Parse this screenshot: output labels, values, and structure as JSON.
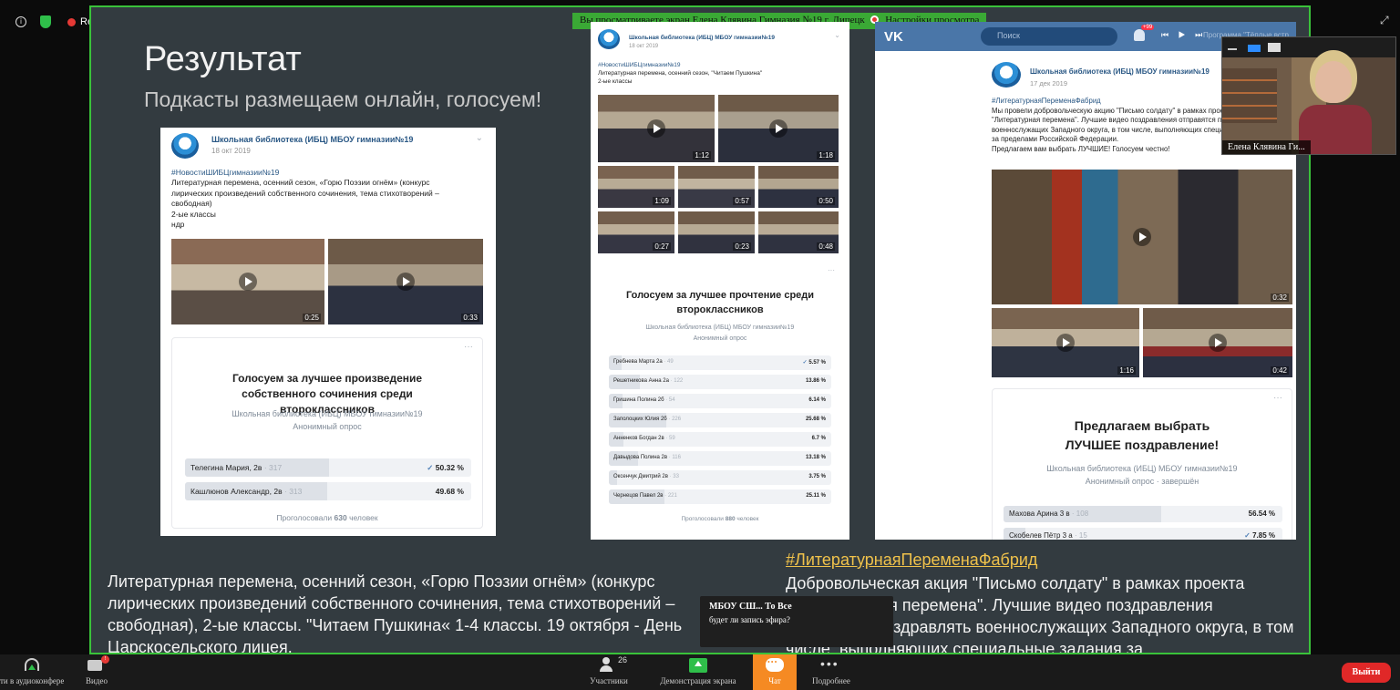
{
  "recording": {
    "label": "Recording"
  },
  "banner": {
    "text": "Вы просматриваете экран Елена Клявина Гимназия №19 г. Липецк",
    "options": "Настройки просмотра"
  },
  "slide": {
    "title": "Результат",
    "subtitle": "Подкасты размещаем онлайн, голосуем!",
    "left_text": "Литературная перемена, осенний сезон, «Горю Поэзии огнём» (конкурс лирических произведений собственного сочинения, тема стихотворений – свободная), 2-ые классы. \"Читаем Пушкина« 1-4 классы. 19 октября - День Царскосельского лицея.",
    "right_tag": "#ЛитературнаяПеременаФабрид",
    "right_text": "Добровольческая акция \"Письмо солдату\" в рамках проекта \"Литературная перемена\". Лучшие видео поздравления отправятся поздравлять военнослужащих Западного округа, в том числе, выполняющих специальные задания за"
  },
  "card1": {
    "org": "Школьная библиотека (ИБЦ) МБОУ гимназии№19",
    "date": "18 окт 2019",
    "tag": "#НовостиШИБЦгимназии№19",
    "text": "Литературная перемена, осенний сезон, «Горю Поэзии огнём» (конкурс лирических произведений собственного сочинения, тема стихотворений – свободная)",
    "classes": "2-ые классы",
    "extra": "ндр",
    "videos": [
      "0:25",
      "0:33"
    ],
    "poll": {
      "title": "Голосуем за лучшее произведение собственного сочинения среди второклассников",
      "org": "Школьная библиотека (ИБЦ) МБОУ гимназии№19",
      "type": "Анонимный опрос",
      "options": [
        {
          "name": "Телегина Мария, 2в",
          "count": "· 317",
          "pct": "50.32 %",
          "fill": 0.5032,
          "checked": "✓"
        },
        {
          "name": "Кашлюнов Александр, 2в",
          "count": "· 313",
          "pct": "49.68 %",
          "fill": 0.4968,
          "checked": ""
        }
      ],
      "voted_prefix": "Проголосовали",
      "voted_count": "630",
      "voted_suffix": "человек"
    }
  },
  "card2": {
    "org": "Школьная библиотека (ИБЦ) МБОУ гимназии№19",
    "date": "18 окт 2019",
    "tag": "#НовостиШИБЦгимназии№19",
    "text": "Литературная перемена, осенний сезон, \"Читаем Пушкина\"",
    "classes": "2-ые классы",
    "videos": [
      "1:12",
      "1:18",
      "1:09",
      "0:57",
      "0:50",
      "0:27",
      "0:23",
      "0:48"
    ],
    "poll": {
      "title": "Голосуем за лучшее прочтение среди второклассников",
      "org": "Школьная библиотека (ИБЦ) МБОУ гимназии№19",
      "type": "Анонимный опрос",
      "options": [
        {
          "name": "Гребнева Марта 2а",
          "count": "· 49",
          "pct": "5.57 %",
          "fill": 0.0557,
          "checked": "✓"
        },
        {
          "name": "Решетникова Анна 2а",
          "count": "· 122",
          "pct": "13.86 %",
          "fill": 0.1386,
          "checked": ""
        },
        {
          "name": "Гришина Полина 2б",
          "count": "· 54",
          "pct": "6.14 %",
          "fill": 0.0614,
          "checked": ""
        },
        {
          "name": "Заполоцких Юлия 2б",
          "count": "· 226",
          "pct": "25.68 %",
          "fill": 0.2568,
          "checked": ""
        },
        {
          "name": "Анненков Богдан 2в",
          "count": "· 59",
          "pct": "6.7 %",
          "fill": 0.067,
          "checked": ""
        },
        {
          "name": "Давыдова Полина 2в",
          "count": "· 116",
          "pct": "13.18 %",
          "fill": 0.1318,
          "checked": ""
        },
        {
          "name": "Оксенчук Дмитрий 2в",
          "count": "· 33",
          "pct": "3.75 %",
          "fill": 0.0375,
          "checked": ""
        },
        {
          "name": "Чернецов Павел 2в",
          "count": "· 221",
          "pct": "25.11 %",
          "fill": 0.2511,
          "checked": ""
        }
      ],
      "voted_prefix": "Проголосовали",
      "voted_count": "880",
      "voted_suffix": "человек"
    }
  },
  "card3": {
    "vk_logo": "VK",
    "search_placeholder": "Поиск",
    "notif_badge": "+99",
    "player": "⏮ ▶ ⏭",
    "now_playing": "Программа \"Тёплые встр",
    "org": "Школьная библиотека (ИБЦ) МБОУ гимназии№19",
    "date": "17 дек 2019",
    "tag": "#ЛитературнаяПеременаФабрид",
    "text": "Мы провели добровольческую акцию \"Письмо солдату\" в рамках проекта \"Литературная перемена\". Лучшие видео поздравления отправятся поздравлять военнослужащих Западного округа, в том числе, выполняющих специальные задания за пределами Российской Федерации.",
    "cta": "Предлагаем вам выбрать ЛУЧШИЕ! Голосуем честно!",
    "videos": [
      "0:32",
      "1:16",
      "0:42"
    ],
    "poll": {
      "title": "Предлагаем выбрать ЛУЧШЕЕ поздравление!",
      "org": "Школьная библиотека (ИБЦ) МБОУ гимназии№19",
      "type": "Анонимный опрос · завершён",
      "options": [
        {
          "name": "Махова Арина 3 в",
          "count": "· 108",
          "pct": "56.54 %",
          "fill": 0.5654,
          "checked": ""
        },
        {
          "name": "Скобелев Пётр 3 а",
          "count": "· 15",
          "pct": "7.85 %",
          "fill": 0.0785,
          "checked": "✓"
        }
      ]
    }
  },
  "webcam": {
    "name": "Елена Клявина Ги..."
  },
  "toast": {
    "from": "МБОУ СШ... То Все",
    "message": "будет ли запись эфира?"
  },
  "toolbar": {
    "audio": "ти в аудиоконфере",
    "video": "Видео",
    "video_badge": "!",
    "participants": "Участники",
    "participants_count": "26",
    "share": "Демонстрация экрана",
    "chat": "Чат",
    "more": "Подробнее",
    "more_icon": "•••",
    "leave": "Выйти"
  },
  "colors": {
    "share_border": "#3ac23a",
    "chat_active": "#f58a23",
    "leave": "#e02828",
    "vk_blue": "#4a76a8",
    "tag_yellow": "#f0c24b"
  }
}
